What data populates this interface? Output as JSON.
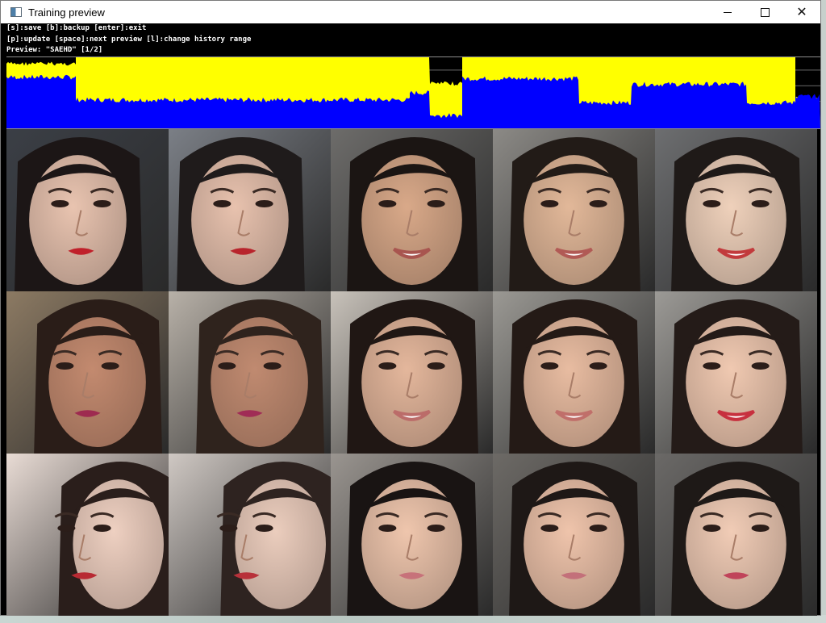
{
  "window": {
    "title": "Training preview",
    "controls": {
      "minimize": "minimize",
      "maximize": "maximize",
      "close": "✕"
    }
  },
  "console": {
    "lines": [
      "[s]:save [b]:backup [enter]:exit",
      "[p]:update [space]:next preview [l]:change history range",
      "Preview: \"SAEHD\" [1/2]"
    ]
  },
  "colors": {
    "graph_yellow": "#ffff00",
    "graph_blue": "#0000ff",
    "background": "#000000",
    "titlebar": "#ffffff"
  },
  "loss_history": {
    "segments": [
      {
        "from": 0,
        "to": 86,
        "yellow_level": 0.94,
        "blue_level": 0.72
      },
      {
        "from": 86,
        "to": 500,
        "yellow_level": 1.0,
        "blue_level": 0.4
      },
      {
        "from": 500,
        "to": 525,
        "yellow_level": 1.0,
        "blue_level": 0.5
      },
      {
        "from": 525,
        "to": 565,
        "yellow_level": 0.66,
        "blue_level": 0.18
      },
      {
        "from": 565,
        "to": 710,
        "yellow_level": 1.0,
        "blue_level": 0.7
      },
      {
        "from": 710,
        "to": 775,
        "yellow_level": 1.0,
        "blue_level": 0.36
      },
      {
        "from": 775,
        "to": 918,
        "yellow_level": 1.0,
        "blue_level": 0.62
      },
      {
        "from": 918,
        "to": 978,
        "yellow_level": 1.0,
        "blue_level": 0.36
      },
      {
        "from": 978,
        "to": 1009,
        "yellow_level": 0.45,
        "blue_level": 0.45
      }
    ]
  },
  "preview_grid": {
    "columns": [
      "source",
      "source-reconstruction",
      "destination",
      "destination-reconstruction",
      "source-to-destination"
    ],
    "rows": [
      {
        "tiles": [
          {
            "skin": "#e9c4b0",
            "hair": "#1c1616",
            "bg": "#3b3f46",
            "lips": "#c0202a",
            "pose": "down",
            "smile": false
          },
          {
            "skin": "#e8c2ae",
            "hair": "#1f1b1b",
            "bg": "#7b7f86",
            "lips": "#b8242c",
            "pose": "down",
            "smile": false
          },
          {
            "skin": "#d9a989",
            "hair": "#1b1513",
            "bg": "#6d6c6a",
            "lips": "#a8554f",
            "pose": "front",
            "smile": true
          },
          {
            "skin": "#e2b899",
            "hair": "#221b17",
            "bg": "#8c8a86",
            "lips": "#b15a55",
            "pose": "front",
            "smile": true
          },
          {
            "skin": "#efd1bb",
            "hair": "#1f1a18",
            "bg": "#6d6e70",
            "lips": "#c23a3c",
            "pose": "front",
            "smile": true
          }
        ]
      },
      {
        "tiles": [
          {
            "skin": "#c38a6f",
            "hair": "#2a1d18",
            "bg": "#8c7a63",
            "lips": "#9e2a50",
            "pose": "side",
            "smile": false
          },
          {
            "skin": "#c08a70",
            "hair": "#2f231d",
            "bg": "#b8b1a8",
            "lips": "#a02c56",
            "pose": "side",
            "smile": false
          },
          {
            "skin": "#e4b79c",
            "hair": "#201714",
            "bg": "#c8c2ba",
            "lips": "#bb6c69",
            "pose": "front",
            "smile": true
          },
          {
            "skin": "#e8bca1",
            "hair": "#241a16",
            "bg": "#9b9994",
            "lips": "#c06f6a",
            "pose": "front",
            "smile": true
          },
          {
            "skin": "#f0c9b1",
            "hair": "#241b18",
            "bg": "#9c9a96",
            "lips": "#c7303e",
            "pose": "front",
            "smile": true
          }
        ]
      },
      {
        "tiles": [
          {
            "skin": "#eed0c1",
            "hair": "#2a1e1b",
            "bg": "#e9dcd5",
            "lips": "#b82a33",
            "pose": "profile",
            "smile": false
          },
          {
            "skin": "#ebcdbd",
            "hair": "#2e2320",
            "bg": "#cfc8c3",
            "lips": "#b8313a",
            "pose": "profile",
            "smile": false
          },
          {
            "skin": "#efc6ad",
            "hair": "#191413",
            "bg": "#9a9590",
            "lips": "#c7727a",
            "pose": "front",
            "smile": false
          },
          {
            "skin": "#efc4ab",
            "hair": "#1e1816",
            "bg": "#6d6a66",
            "lips": "#c3707a",
            "pose": "front",
            "smile": false
          },
          {
            "skin": "#f1ccb6",
            "hair": "#1e1917",
            "bg": "#6b6967",
            "lips": "#c0435a",
            "pose": "front",
            "smile": false
          }
        ]
      }
    ]
  }
}
